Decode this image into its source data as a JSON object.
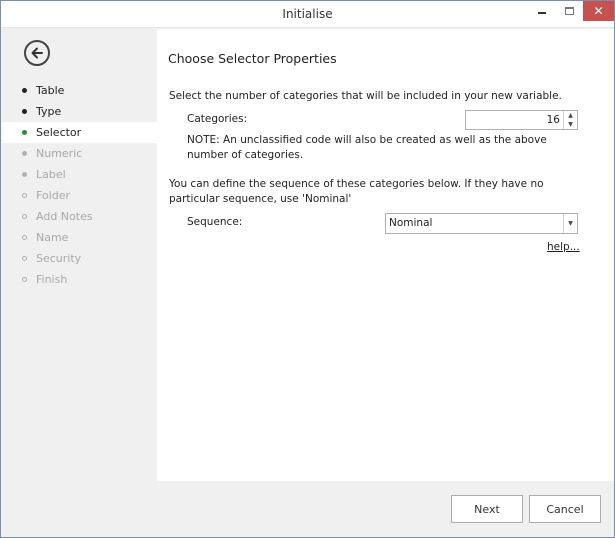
{
  "window": {
    "title": "Initialise",
    "close_glyph": "✕"
  },
  "sidebar": {
    "back_icon": "back-arrow-circle-icon",
    "steps": [
      {
        "label": "Table",
        "state": "done"
      },
      {
        "label": "Type",
        "state": "done"
      },
      {
        "label": "Selector",
        "state": "active"
      },
      {
        "label": "Numeric",
        "state": "disabled"
      },
      {
        "label": "Label",
        "state": "disabled"
      },
      {
        "label": "Folder",
        "state": "disabled"
      },
      {
        "label": "Add Notes",
        "state": "disabled"
      },
      {
        "label": "Name",
        "state": "disabled"
      },
      {
        "label": "Security",
        "state": "disabled"
      },
      {
        "label": "Finish",
        "state": "disabled"
      }
    ]
  },
  "content": {
    "heading": "Choose Selector Properties",
    "intro": "Select the number of categories that will be included in your new variable.",
    "categories_label": "Categories:",
    "categories_value": "16",
    "note": "NOTE: An unclassified code will also be created as well as the above number of categories.",
    "sequence_desc": "You can define the sequence of these categories below. If they have no particular sequence, use 'Nominal'",
    "sequence_label": "Sequence:",
    "sequence_value": "Nominal",
    "help_link": "help..."
  },
  "footer": {
    "next_label": "Next",
    "cancel_label": "Cancel"
  },
  "colors": {
    "active_dot": "#2e8b3a",
    "close_button": "#c75050",
    "disabled_text": "#a8a8a8"
  }
}
